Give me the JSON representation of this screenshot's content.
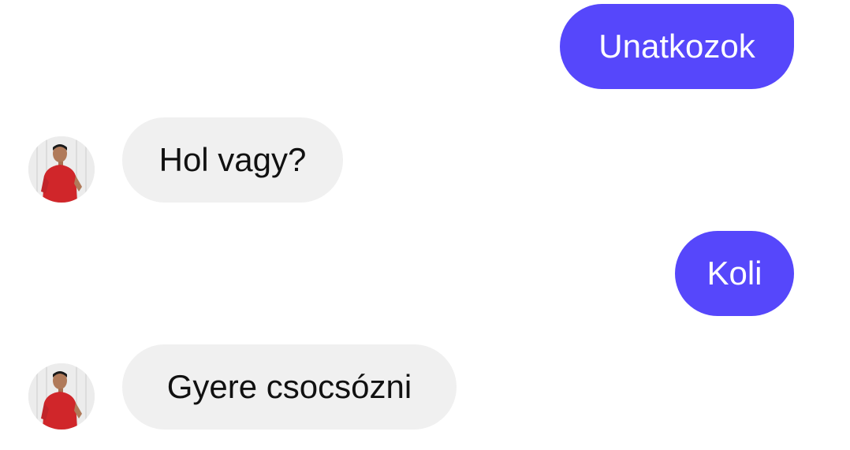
{
  "messages": [
    {
      "sender": "me",
      "text": "Unatkozok"
    },
    {
      "sender": "contact",
      "text": "Hol vagy?"
    },
    {
      "sender": "me",
      "text": "Koli"
    },
    {
      "sender": "contact",
      "text": "Gyere csocsózni"
    }
  ],
  "colors": {
    "sent_bubble": "#5647fb",
    "received_bubble": "#f0f0f0",
    "background": "#ffffff"
  },
  "icons": {
    "contact_avatar": "contact-avatar-photo"
  }
}
